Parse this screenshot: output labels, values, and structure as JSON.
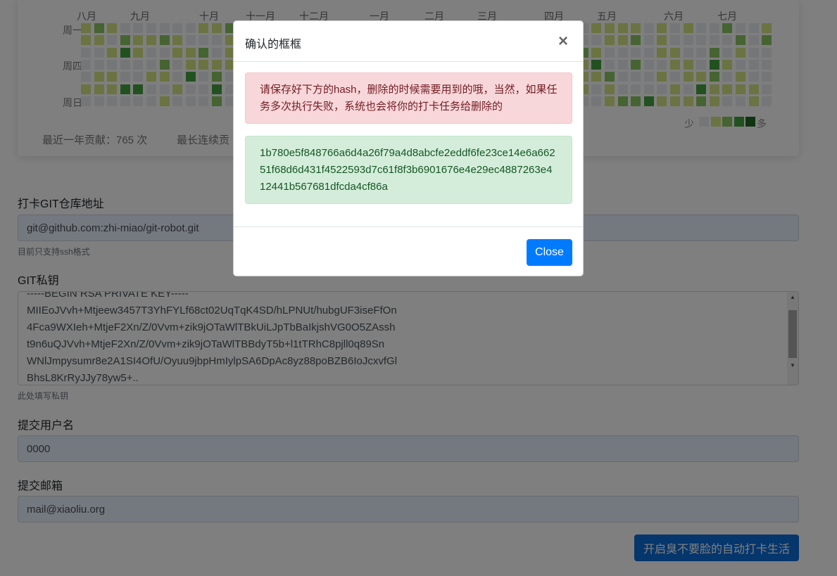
{
  "contributions": {
    "months": [
      "八月",
      "九月",
      "十月",
      "十一月",
      "十二月",
      "一月",
      "二月",
      "三月",
      "四月",
      "五月",
      "六月",
      "七月"
    ],
    "weekdays": [
      "周一",
      "周四",
      "周日"
    ],
    "total_label": "最近一年贡献：765 次",
    "streak_label": "最长连续贡",
    "legend_less": "少",
    "legend_more": "多",
    "colors": [
      "#ebedf0",
      "#d6e685",
      "#8cc665",
      "#44a340",
      "#1e6823"
    ]
  },
  "form": {
    "repo_label": "打卡GIT仓库地址",
    "repo_value": "git@github.com:zhi-miao/git-robot.git",
    "repo_help": "目前只支持ssh格式",
    "key_label": "GIT私钥",
    "key_lines": [
      "-----BEGIN RSA PRIVATE KEY-----",
      "MIIEoJVvh+Mtjeew3457T3YhFYLf68ct02UqTqK4SD/hLPNUt/hubgUF3iseFfOn",
      "4Fca9WXIeh+MtjeF2Xn/Z/0Vvm+zik9jOTaWlTBkUiLJpTbBaIkjshVG0O5ZAssh",
      "t9n6uQJVvh+MtjeF2Xn/Z/0Vvm+zik9jOTaWlTBBdyT5b+l1tTRhC8pjll0q89Sn",
      "WNlJmpysumr8e2A1SI4OfU/Oyuu9jbpHmIylpSA6DpAc8yz88poBZB6IoJcxvfGl",
      "BhsL8KrRyJJy78yw5+.."
    ],
    "key_help": "此处填写私钥",
    "user_label": "提交用户名",
    "user_value": "0000",
    "email_label": "提交邮箱",
    "email_value": "mail@xiaoliu.org",
    "submit_label": "开启臭不要脸的自动打卡生活"
  },
  "modal": {
    "title": "确认的框框",
    "close_icon": "×",
    "warning": "请保存好下方的hash，删除的时候需要用到的哦，当然，如果任务多次执行失败，系统也会将你的打卡任务给删除的",
    "hash": "1b780e5f848766a6d4a26f79a4d8abcfe2eddf6fe23ce14e6a66251f68d6d431f4522593d7c61f8f3b6901676e4e29ec4887263e412441b567681dfcda4cf86a",
    "close_label": "Close"
  }
}
